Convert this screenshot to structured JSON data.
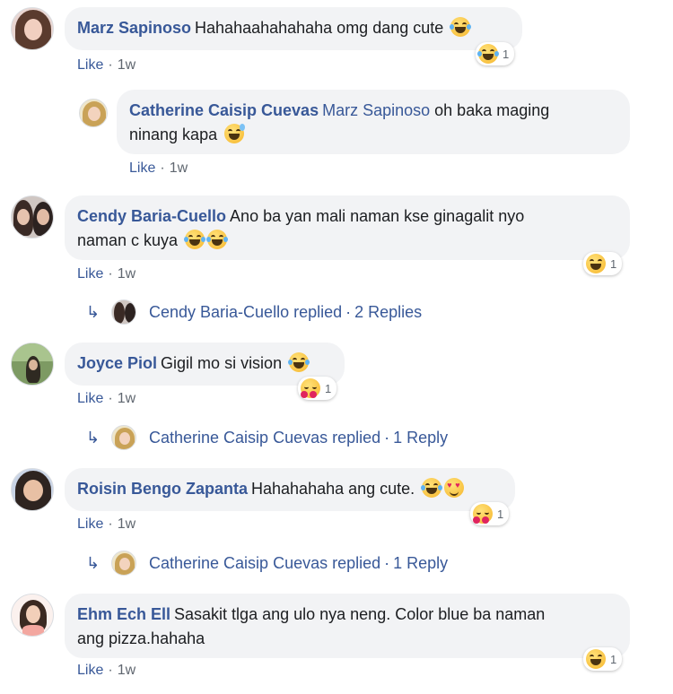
{
  "comments": [
    {
      "author": "Marz Sapinoso",
      "text": "Hahahaahahahaha omg dang cute",
      "reaction_count": "1",
      "like_label": "Like",
      "time": "1w"
    },
    {
      "author": "Catherine Caisip Cuevas",
      "mention": "Marz Sapinoso",
      "text": "oh baka maging",
      "text2": "ninang kapa",
      "like_label": "Like",
      "time": "1w"
    },
    {
      "author": "Cendy Baria-Cuello",
      "text": "Ano ba yan mali naman kse ginagalit nyo",
      "text2": "naman c kuya",
      "reaction_count": "1",
      "like_label": "Like",
      "time": "1w",
      "replies_text": "Cendy Baria-Cuello replied",
      "replies_count": "2 Replies"
    },
    {
      "author": "Joyce Piol",
      "text": "Gigil mo si vision",
      "reaction_count": "1",
      "like_label": "Like",
      "time": "1w",
      "replies_text": "Catherine Caisip Cuevas replied",
      "replies_count": "1 Reply"
    },
    {
      "author": "Roisin Bengo Zapanta",
      "text": "Hahahahaha ang cute.",
      "reaction_count": "1",
      "like_label": "Like",
      "time": "1w",
      "replies_text": "Catherine Caisip Cuevas replied",
      "replies_count": "1 Reply"
    },
    {
      "author": "Ehm Ech Ell",
      "text": "Sasakit tlga ang ulo nya neng. Color blue ba naman",
      "text2": "ang pizza.hahaha",
      "reaction_count": "1",
      "like_label": "Like",
      "time": "1w"
    }
  ],
  "separator": "·",
  "colors": {
    "link": "#385898",
    "bubble": "#f2f3f5",
    "meta": "#606770"
  }
}
